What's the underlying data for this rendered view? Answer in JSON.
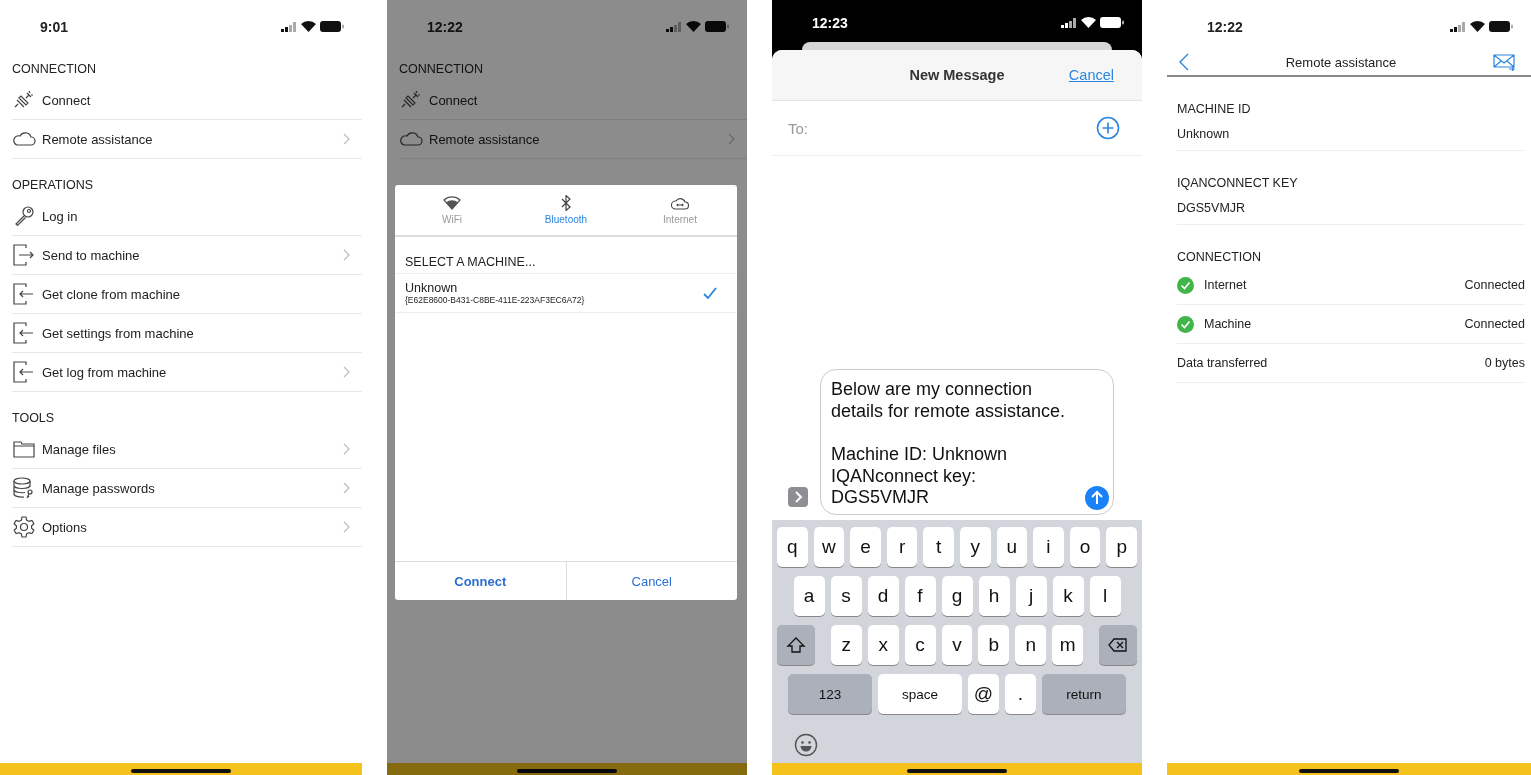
{
  "screens": [
    {
      "kind": "menu",
      "status_time": "9:01",
      "sections": [
        {
          "title": "CONNECTION",
          "items": [
            {
              "label": "Connect",
              "chevron": false
            },
            {
              "label": "Remote assistance",
              "chevron": true
            }
          ]
        },
        {
          "title": "OPERATIONS",
          "items": [
            {
              "label": "Log in",
              "chevron": false
            },
            {
              "label": "Send to machine",
              "chevron": true
            },
            {
              "label": "Get clone from machine",
              "chevron": false
            },
            {
              "label": "Get settings from machine",
              "chevron": false
            },
            {
              "label": "Get log from machine",
              "chevron": true
            }
          ]
        },
        {
          "title": "TOOLS",
          "items": [
            {
              "label": "Manage files",
              "chevron": true
            },
            {
              "label": "Manage passwords",
              "chevron": true
            },
            {
              "label": "Options",
              "chevron": true
            }
          ]
        }
      ]
    },
    {
      "kind": "picker",
      "status_time": "12:22",
      "sections": [
        {
          "title": "CONNECTION",
          "items": [
            {
              "label": "Connect",
              "chevron": false
            },
            {
              "label": "Remote assistance",
              "chevron": true
            }
          ]
        }
      ],
      "dialog": {
        "tabs": [
          {
            "label": "WiFi",
            "selected": false
          },
          {
            "label": "Bluetooth",
            "selected": true
          },
          {
            "label": "Internet",
            "selected": false
          }
        ],
        "heading": "SELECT A MACHINE...",
        "machines": [
          {
            "name": "Unknown",
            "id": "{E62E8600-B431-C8BE-411E-223AF3EC6A72}",
            "selected": true
          }
        ],
        "buttons": [
          "Connect",
          "Cancel"
        ]
      }
    },
    {
      "kind": "compose",
      "status_time": "12:23",
      "title": "New Message",
      "cancel": "Cancel",
      "to_label": "To:",
      "message": "Below are my connection details for remote assistance.\n\nMachine ID: Unknown\nIQANconnect key: DGS5VMJR",
      "keyboard": [
        [
          {
            "kind": "letter",
            "label": "q"
          },
          {
            "kind": "letter",
            "label": "w"
          },
          {
            "kind": "letter",
            "label": "e"
          },
          {
            "kind": "letter",
            "label": "r"
          },
          {
            "kind": "letter",
            "label": "t"
          },
          {
            "kind": "letter",
            "label": "y"
          },
          {
            "kind": "letter",
            "label": "u"
          },
          {
            "kind": "letter",
            "label": "i"
          },
          {
            "kind": "letter",
            "label": "o"
          },
          {
            "kind": "letter",
            "label": "p"
          }
        ],
        [
          {
            "kind": "letter",
            "label": "a"
          },
          {
            "kind": "letter",
            "label": "s"
          },
          {
            "kind": "letter",
            "label": "d"
          },
          {
            "kind": "letter",
            "label": "f"
          },
          {
            "kind": "letter",
            "label": "g"
          },
          {
            "kind": "letter",
            "label": "h"
          },
          {
            "kind": "letter",
            "label": "j"
          },
          {
            "kind": "letter",
            "label": "k"
          },
          {
            "kind": "letter",
            "label": "l"
          }
        ],
        [
          {
            "kind": "shift"
          },
          {
            "kind": "letter",
            "label": "z"
          },
          {
            "kind": "letter",
            "label": "x"
          },
          {
            "kind": "letter",
            "label": "c"
          },
          {
            "kind": "letter",
            "label": "v"
          },
          {
            "kind": "letter",
            "label": "b"
          },
          {
            "kind": "letter",
            "label": "n"
          },
          {
            "kind": "letter",
            "label": "m"
          },
          {
            "kind": "delete"
          }
        ],
        [
          {
            "kind": "function",
            "label": "123"
          },
          {
            "kind": "space",
            "label": "space"
          },
          {
            "kind": "letter",
            "label": "@"
          },
          {
            "kind": "letter",
            "label": "."
          },
          {
            "kind": "function",
            "label": "return"
          }
        ]
      ]
    },
    {
      "kind": "details",
      "status_time": "12:22",
      "title": "Remote assistance",
      "fields": [
        {
          "label": "MACHINE ID",
          "value": "Unknown"
        },
        {
          "label": "IQANCONNECT KEY",
          "value": "DGS5VMJR"
        }
      ],
      "connection_title": "CONNECTION",
      "rows": [
        {
          "kind": "status",
          "label": "Internet",
          "value": "Connected",
          "connected": true
        },
        {
          "kind": "status",
          "label": "Machine",
          "value": "Connected",
          "connected": true
        },
        {
          "kind": "plain",
          "label": "Data transferred",
          "value": "0 bytes"
        }
      ]
    }
  ]
}
